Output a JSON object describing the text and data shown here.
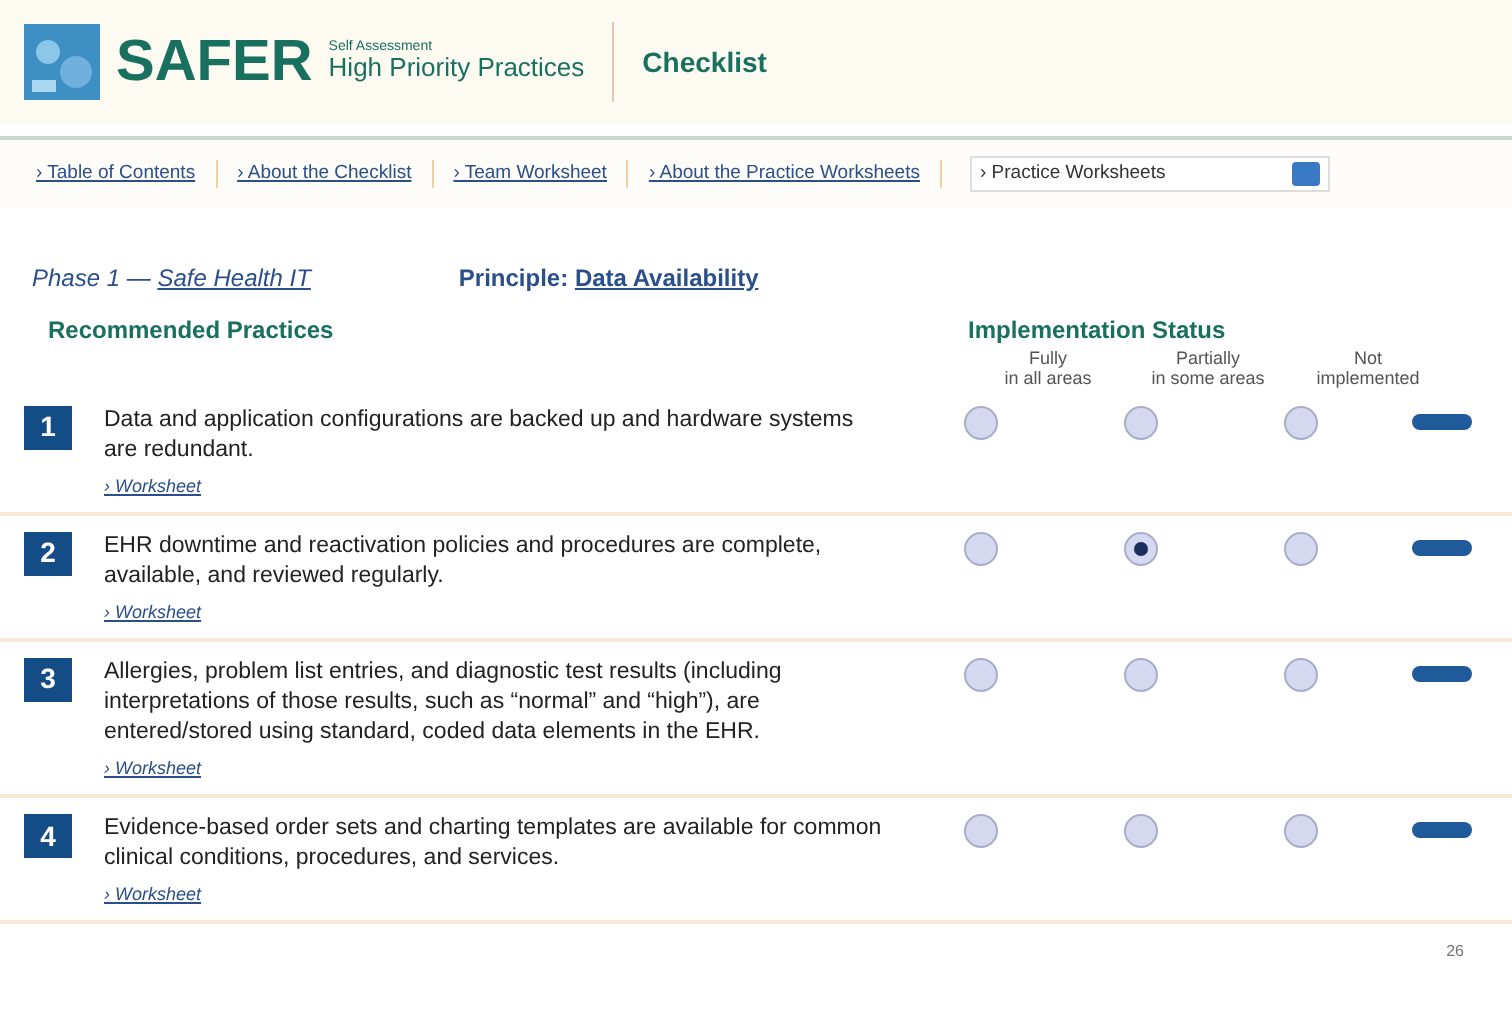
{
  "header": {
    "logo": "SAFER",
    "subtitle_small": "Self Assessment",
    "subtitle": "High Priority Practices",
    "section": "Checklist"
  },
  "nav": [
    {
      "label": "› Table of Contents"
    },
    {
      "label": "› About the Checklist"
    },
    {
      "label": "› Team Worksheet"
    },
    {
      "label": "› About the Practice Worksheets"
    }
  ],
  "nav_select": {
    "value": "› Practice Worksheets"
  },
  "phase": {
    "prefix": "Phase 1 —",
    "link": "Safe Health IT"
  },
  "principle": {
    "label": "Principle:",
    "link": "Data Availability"
  },
  "columns": {
    "practices": "Recommended Practices",
    "status": "Implementation Status",
    "options": [
      {
        "line1": "Fully",
        "line2": "in all areas"
      },
      {
        "line1": "Partially",
        "line2": "in some areas"
      },
      {
        "line1": "Not",
        "line2": "implemented"
      }
    ]
  },
  "practices": [
    {
      "number": "1",
      "text": "Data and application configurations are backed up and hardware systems are redundant.",
      "worksheet": "› Worksheet",
      "selected": [
        false,
        false,
        false
      ]
    },
    {
      "number": "2",
      "text": "EHR downtime and reactivation policies and procedures are complete, available, and reviewed regularly.",
      "worksheet": "› Worksheet",
      "selected": [
        false,
        true,
        false
      ]
    },
    {
      "number": "3",
      "text": "Allergies, problem list entries, and diagnostic test results (including interpretations of those results, such as “normal” and “high”), are entered/stored using standard, coded data elements in the EHR.",
      "worksheet": "› Worksheet",
      "selected": [
        false,
        false,
        false
      ]
    },
    {
      "number": "4",
      "text": "Evidence-based order sets and charting templates are available for common clinical conditions, procedures, and services.",
      "worksheet": "› Worksheet",
      "selected": [
        false,
        false,
        false
      ]
    }
  ],
  "page_number": "26"
}
